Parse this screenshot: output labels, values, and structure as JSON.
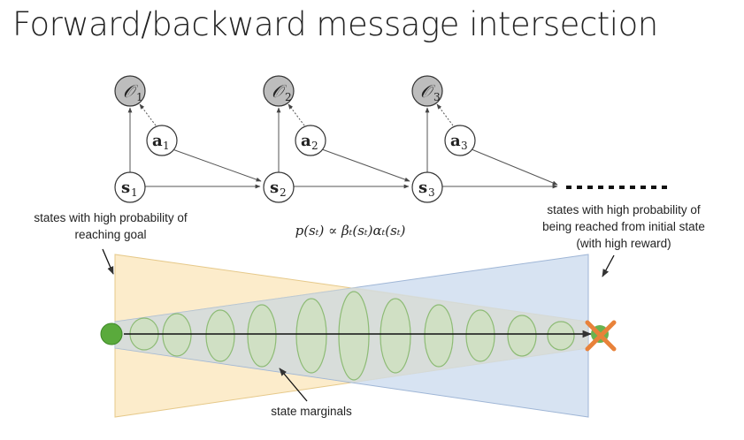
{
  "title": "Forward/backward message intersection",
  "graph": {
    "observations": [
      {
        "sym": "𝒪",
        "sub": "1"
      },
      {
        "sym": "𝒪",
        "sub": "2"
      },
      {
        "sym": "𝒪",
        "sub": "3"
      }
    ],
    "actions": [
      {
        "sym": "a",
        "sub": "1"
      },
      {
        "sym": "a",
        "sub": "2"
      },
      {
        "sym": "a",
        "sub": "3"
      }
    ],
    "states": [
      {
        "sym": "s",
        "sub": "1"
      },
      {
        "sym": "s",
        "sub": "2"
      },
      {
        "sym": "s",
        "sub": "3"
      }
    ]
  },
  "formula": "p(sₜ) ∝ βₜ(sₜ)αₜ(sₜ)",
  "annotations": {
    "left_line1": "states with high probability of",
    "left_line2": "reaching goal",
    "right_line1": "states with high probability of",
    "right_line2": "being reached from initial state",
    "right_line3": "(with high reward)",
    "bottom": "state marginals"
  },
  "colors": {
    "backward_region": "#fbe9c2",
    "forward_region": "#cddcef",
    "marginal_fill": "#cfe0c0",
    "marginal_stroke": "#8dbb75",
    "start_dot": "#5aaa3c",
    "goal_x": "#e8823a",
    "observed_node": "#bdbdbd"
  }
}
